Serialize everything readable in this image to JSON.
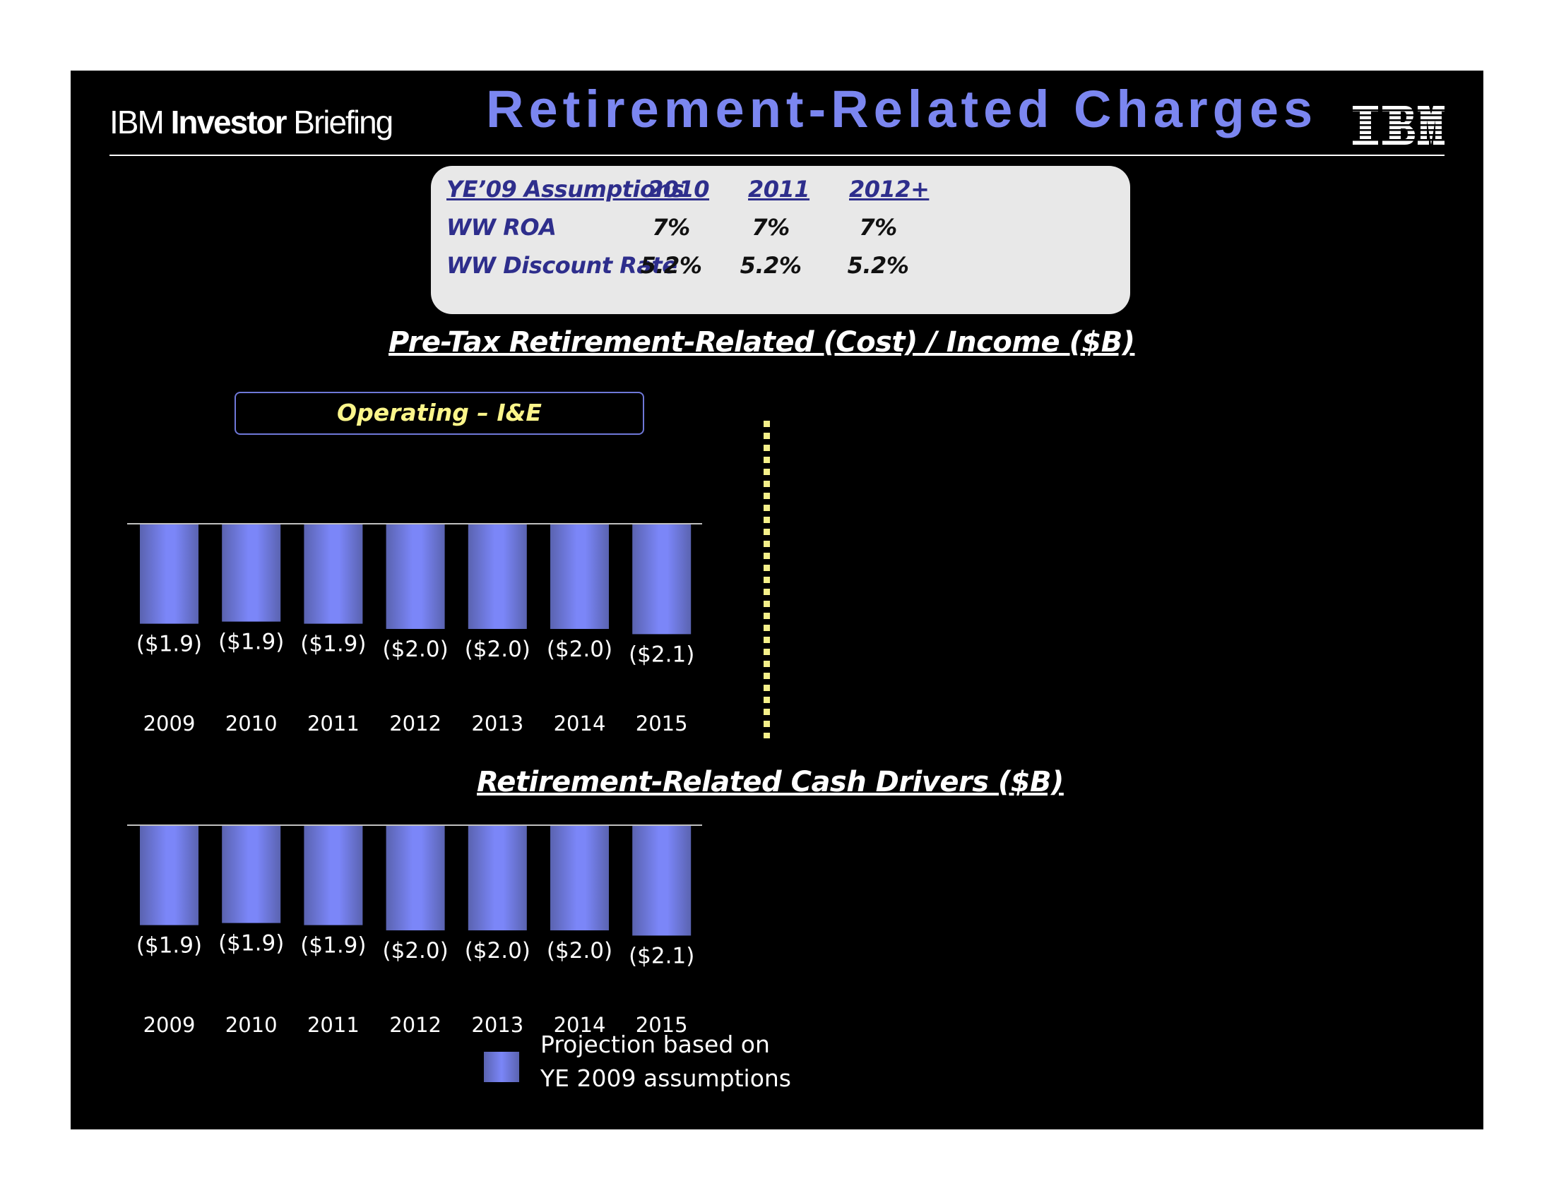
{
  "header": {
    "brand_prefix": "IBM",
    "brand_bold": "Investor",
    "brand_suffix": "Briefing",
    "title": "Retirement-Related Charges",
    "logo": "IBM",
    "title_color": "#7b86f0"
  },
  "assumptions": {
    "header_label": "YE’09 Assumptions",
    "years": [
      "2010",
      "2011",
      "2012+"
    ],
    "rows": [
      {
        "label": "WW ROA",
        "values": [
          "7%",
          "7%",
          "7%"
        ]
      },
      {
        "label": "WW Discount Rate",
        "values": [
          "5.2%",
          "5.2%",
          "5.2%"
        ]
      }
    ]
  },
  "pretax_section": {
    "title": "Pre-Tax Retirement-Related (Cost) / Income ($B)",
    "operating_label": "Operating – I&E"
  },
  "cash_section": {
    "title": "Retirement-Related Cash Drivers ($B)"
  },
  "legend": {
    "line1": "Projection based on",
    "line2": "YE 2009 assumptions"
  },
  "colors": {
    "bar_center": "#7b86f8",
    "bar_edge": "#5a63b0",
    "divider": "#f5f08a",
    "operating_text": "#fbf58a"
  },
  "chart_data": [
    {
      "type": "bar",
      "title": "Pre-Tax Retirement-Related (Cost) / Income ($B) - Operating I&E",
      "categories": [
        "2009",
        "2010",
        "2011",
        "2012",
        "2013",
        "2014",
        "2015"
      ],
      "values": [
        -1.9,
        -1.9,
        -1.9,
        -2.0,
        -2.0,
        -2.0,
        -2.1
      ],
      "data_labels": [
        "($1.9)",
        "($1.9)",
        "($1.9)",
        "($2.0)",
        "($2.0)",
        "($2.0)",
        "($2.1)"
      ],
      "xlabel": "",
      "ylabel": "$B",
      "ylim": [
        -2.2,
        0
      ],
      "grid": false,
      "legend": "bottom"
    },
    {
      "type": "bar",
      "title": "Retirement-Related Cash Drivers ($B)",
      "categories": [
        "2009",
        "2010",
        "2011",
        "2012",
        "2013",
        "2014",
        "2015"
      ],
      "values": [
        -1.9,
        -1.9,
        -1.9,
        -2.0,
        -2.0,
        -2.0,
        -2.1
      ],
      "data_labels": [
        "($1.9)",
        "($1.9)",
        "($1.9)",
        "($2.0)",
        "($2.0)",
        "($2.0)",
        "($2.1)"
      ],
      "xlabel": "",
      "ylabel": "$B",
      "ylim": [
        -2.2,
        0
      ],
      "grid": false,
      "legend": "bottom"
    }
  ]
}
